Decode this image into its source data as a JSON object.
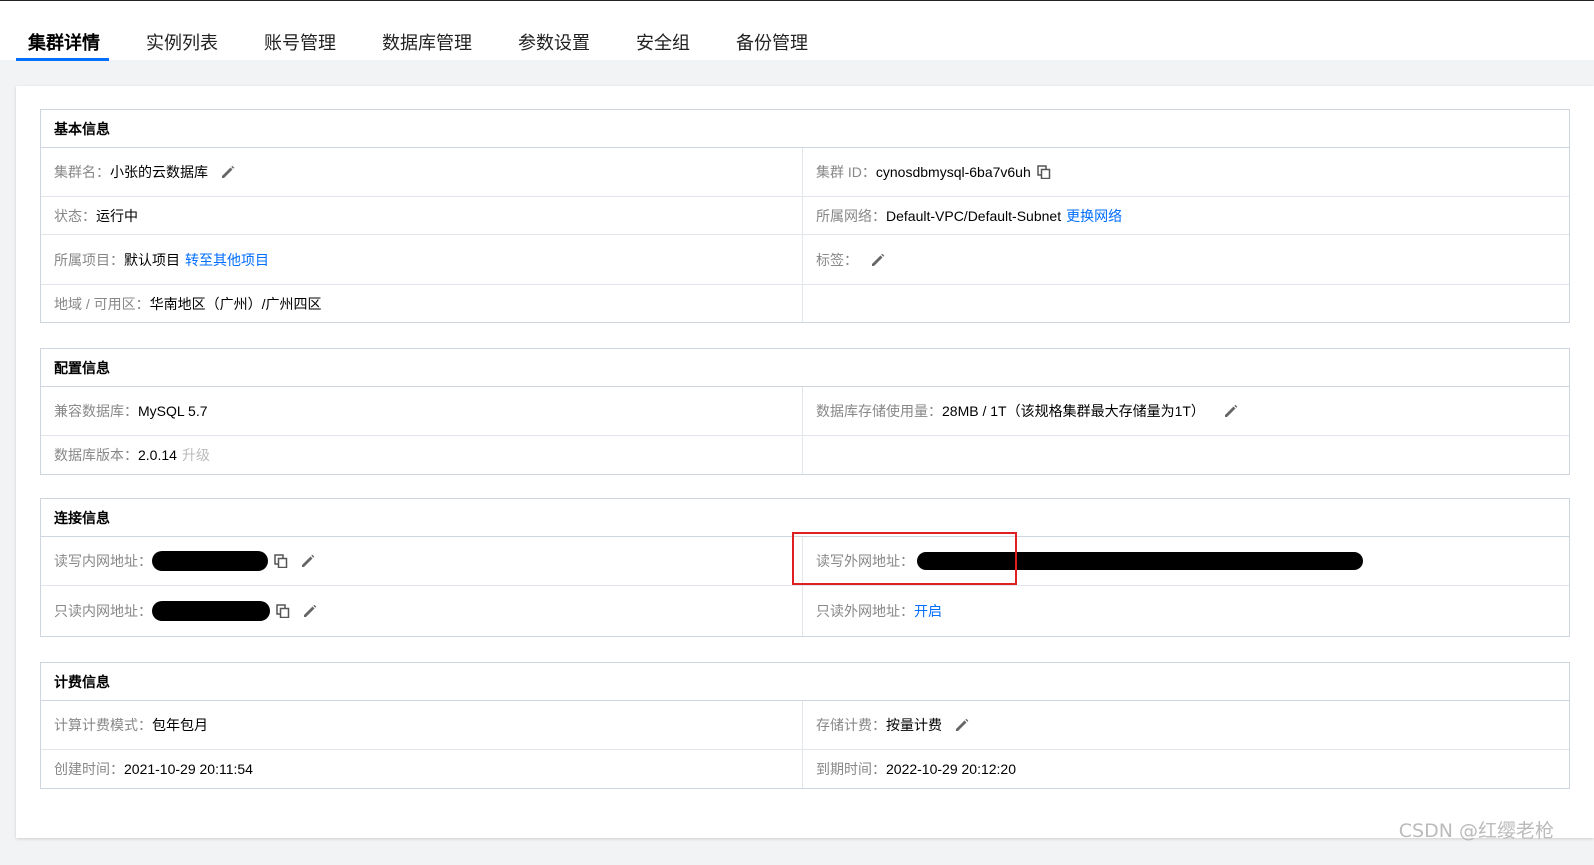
{
  "tabs": [
    "集群详情",
    "实例列表",
    "账号管理",
    "数据库管理",
    "参数设置",
    "安全组",
    "备份管理"
  ],
  "basic": {
    "title": "基本信息",
    "cluster_name_label": "集群名：",
    "cluster_name": "小张的云数据库",
    "cluster_id_label": "集群 ID：",
    "cluster_id": "cynosdbmysql-6ba7v6uh",
    "status_label": "状态：",
    "status": "运行中",
    "network_label": "所属网络：",
    "network": "Default-VPC/Default-Subnet",
    "network_link": "更换网络",
    "project_label": "所属项目：",
    "project": "默认项目",
    "project_link": "转至其他项目",
    "tags_label": "标签：",
    "region_label": "地域 / 可用区：",
    "region": "华南地区（广州）/广州四区"
  },
  "config": {
    "title": "配置信息",
    "db_label": "兼容数据库：",
    "db": "MySQL 5.7",
    "storage_label": "数据库存储使用量：",
    "storage": "28MB / 1T（该规格集群最大存储量为1T）",
    "version_label": "数据库版本：",
    "version": "2.0.14",
    "upgrade_link": "升级"
  },
  "connection": {
    "title": "连接信息",
    "rw_private_label": "读写内网地址：",
    "rw_public_label": "读写外网地址：",
    "ro_private_label": "只读内网地址：",
    "ro_public_label": "只读外网地址：",
    "ro_public_link": "开启"
  },
  "billing": {
    "title": "计费信息",
    "compute_label": "计算计费模式：",
    "compute": "包年包月",
    "storage_billing_label": "存储计费：",
    "storage_billing": "按量计费",
    "created_label": "创建时间：",
    "created": "2021-10-29 20:11:54",
    "expire_label": "到期时间：",
    "expire": "2022-10-29 20:12:20"
  },
  "watermark": "CSDN @红缨老枪",
  "colors": {
    "link": "#006eff",
    "label": "#888888",
    "border": "#cfd5de",
    "highlight": "#e02020"
  }
}
